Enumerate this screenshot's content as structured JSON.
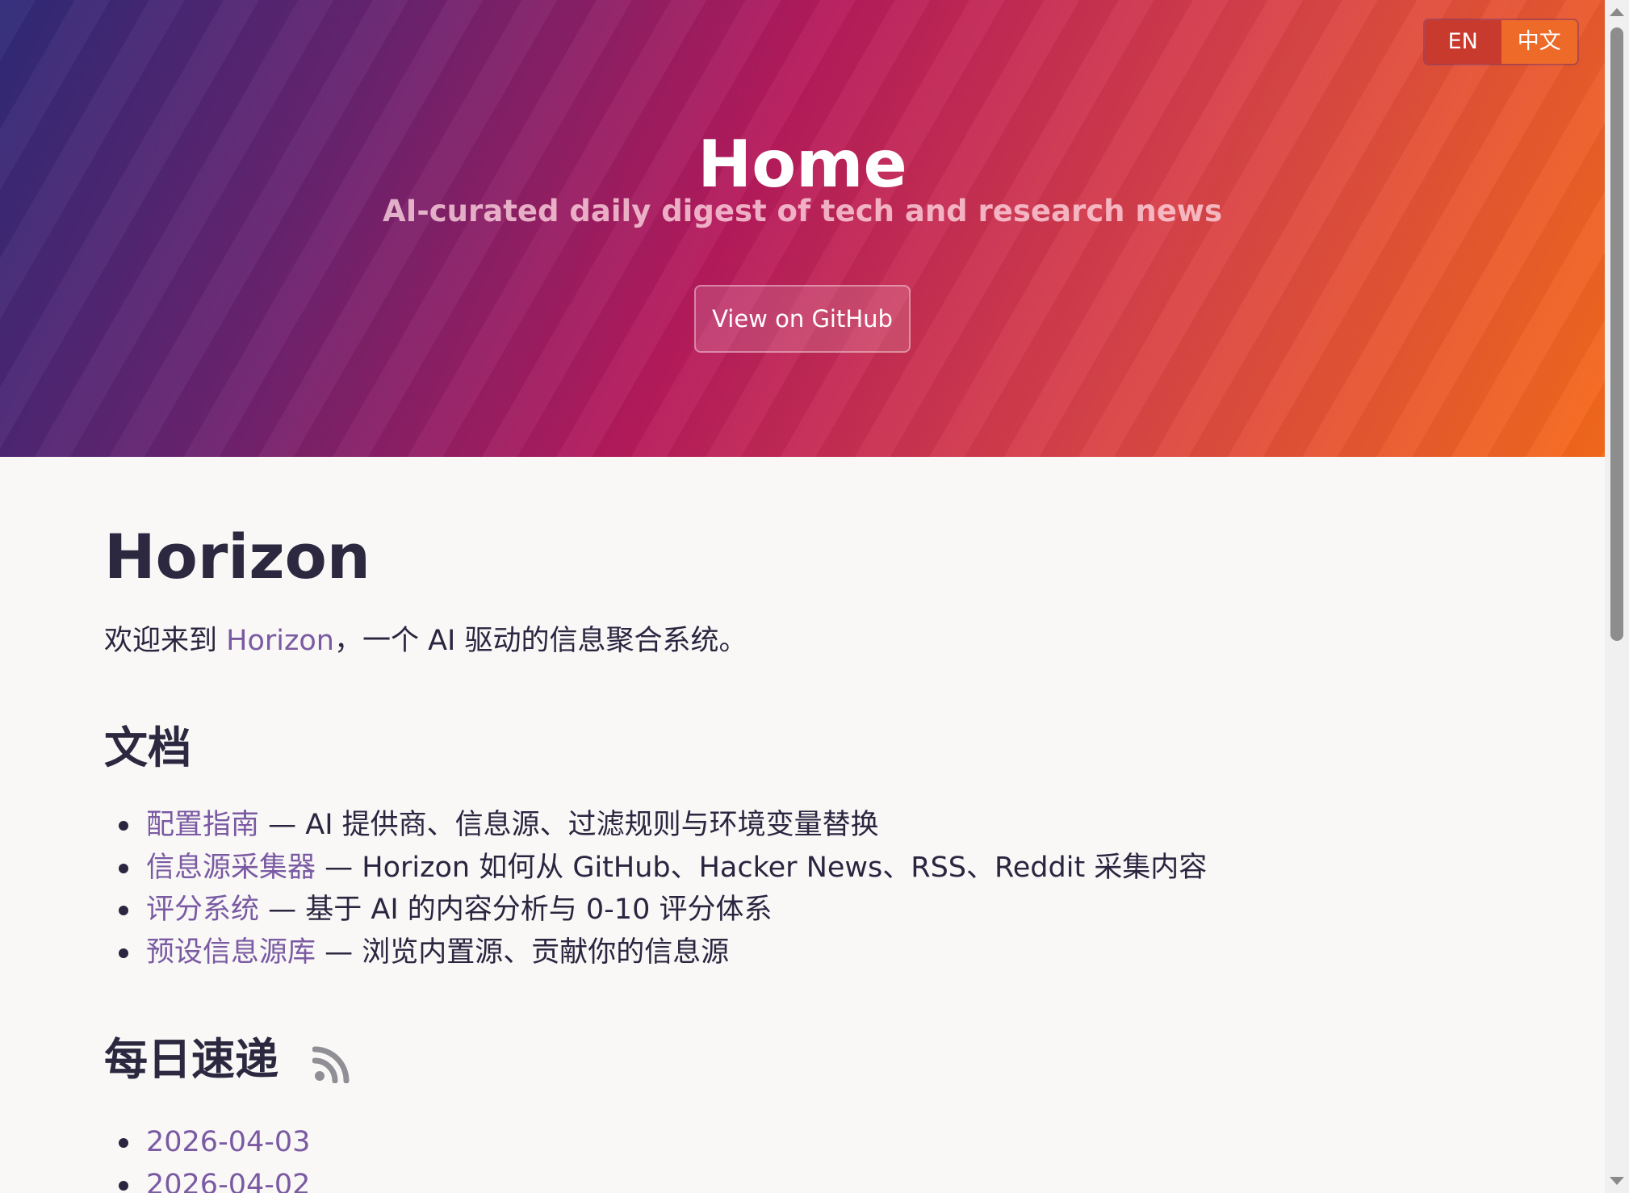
{
  "hero": {
    "title": "Home",
    "subtitle": "AI-curated daily digest of tech and research news",
    "github_button": "View on GitHub"
  },
  "language_switcher": {
    "options": [
      "EN",
      "中文"
    ],
    "selected": "EN"
  },
  "main": {
    "title": "Horizon",
    "intro": {
      "prefix": "欢迎来到 ",
      "link_text": "Horizon",
      "suffix": "，一个 AI 驱动的信息聚合系统。"
    },
    "docs": {
      "heading": "文档",
      "items": [
        {
          "link": "配置指南",
          "description": " — AI 提供商、信息源、过滤规则与环境变量替换"
        },
        {
          "link": "信息源采集器",
          "description": " — Horizon 如何从 GitHub、Hacker News、RSS、Reddit 采集内容"
        },
        {
          "link": "评分系统",
          "description": " — 基于 AI 的内容分析与 0-10 评分体系"
        },
        {
          "link": "预设信息源库",
          "description": " — 浏览内置源、贡献你的信息源"
        }
      ]
    },
    "daily": {
      "heading": "每日速递",
      "icon": "rss-icon",
      "items": [
        "2026-04-03",
        "2026-04-02"
      ]
    }
  },
  "colors": {
    "link": "#7a5aa3",
    "text": "#2b2540",
    "background": "#f9f8f6",
    "hero_gradient": [
      "#2f2a78",
      "#b71b5c",
      "#f66b1b"
    ]
  }
}
